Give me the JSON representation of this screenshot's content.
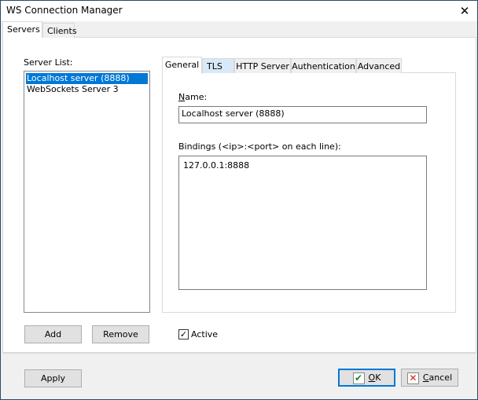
{
  "window": {
    "title": "WS Connection Manager",
    "close_icon": "close-icon"
  },
  "outer_tabs": [
    {
      "label": "Servers",
      "selected": true
    },
    {
      "label": "Clients",
      "selected": false
    }
  ],
  "server_list": {
    "label": "Server List:",
    "items": [
      {
        "label": "Localhost server (8888)",
        "selected": true
      },
      {
        "label": "WebSockets Server 3",
        "selected": false
      }
    ],
    "add_label": "Add",
    "remove_label": "Remove"
  },
  "inner_tabs": [
    {
      "label": "General",
      "selected": true
    },
    {
      "label": "TLS",
      "hover": true
    },
    {
      "label": "HTTP Server"
    },
    {
      "label": "Authentication"
    },
    {
      "label": "Advanced"
    }
  ],
  "general": {
    "name_label_accel": "N",
    "name_label_rest": "ame:",
    "name_value": "Localhost server (8888)",
    "bindings_label": "Bindings (<ip>:<port> on each line):",
    "bindings_value": "127.0.0.1:8888"
  },
  "active": {
    "label": "Active",
    "checked": true
  },
  "footer": {
    "apply_label": "Apply",
    "ok_accel": "O",
    "ok_rest": "K",
    "cancel_accel": "C",
    "cancel_rest": "ancel"
  },
  "colors": {
    "selection": "#0078d7",
    "ok_border": "#0078d7",
    "ok_check": "#1a8a1a",
    "cancel_x": "#d0201a"
  }
}
